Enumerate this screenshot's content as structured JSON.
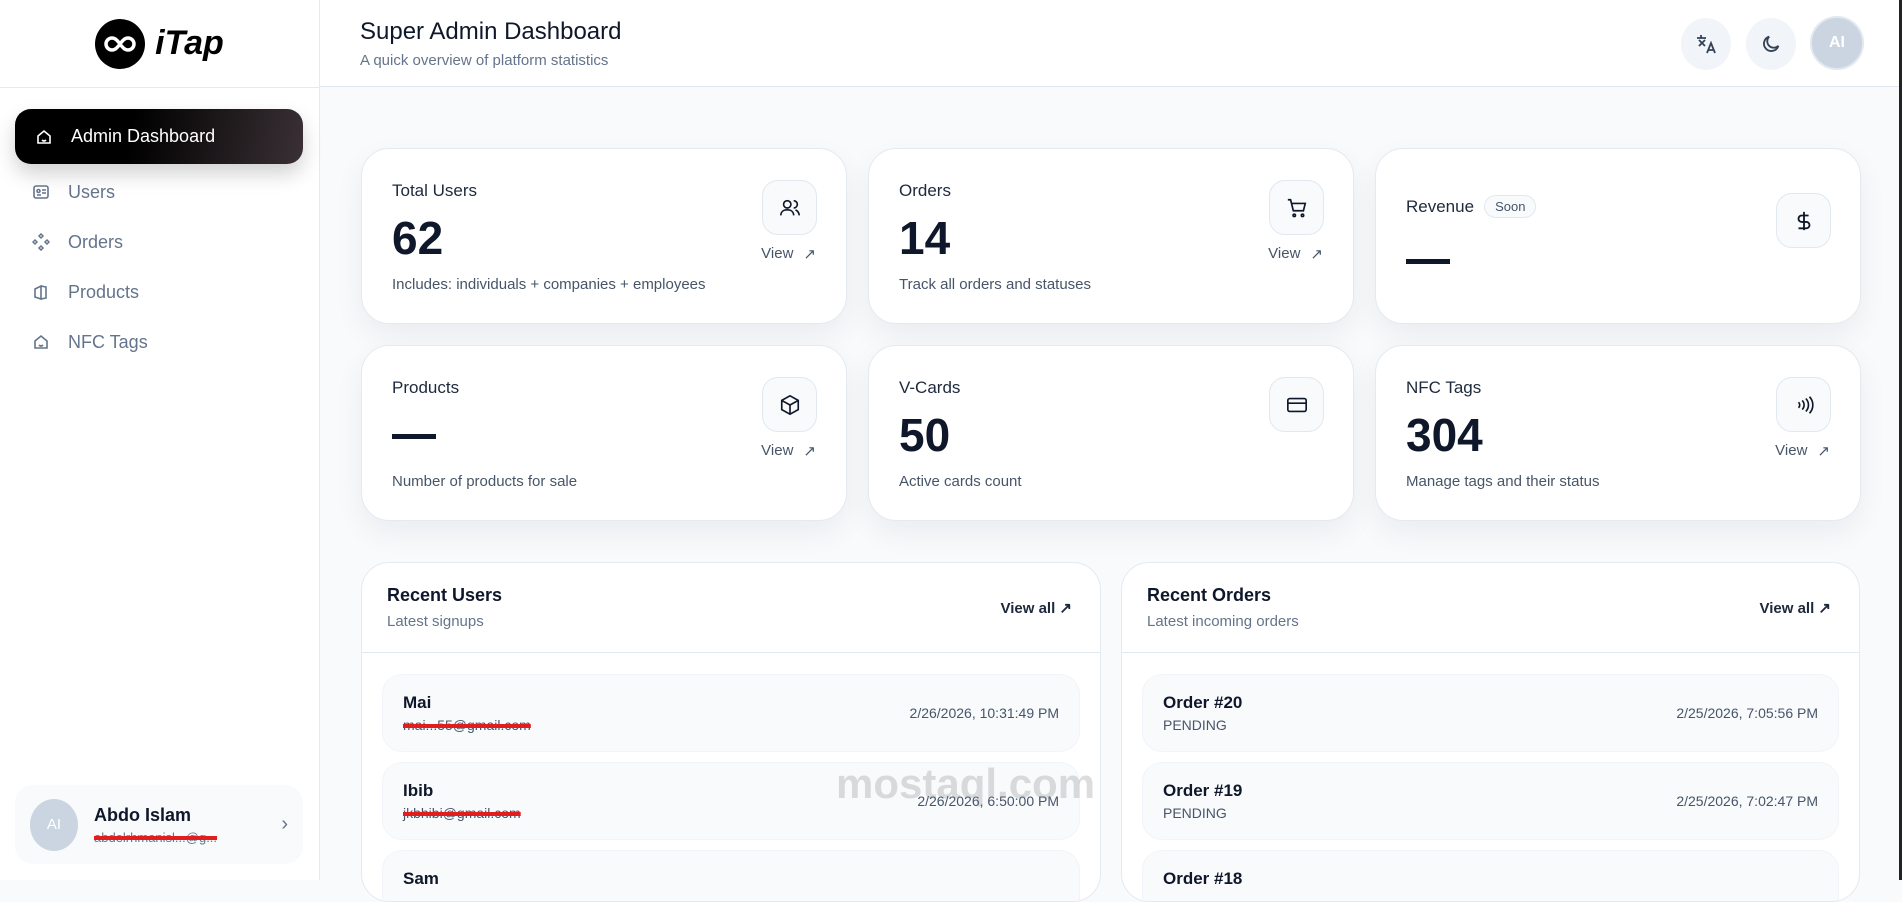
{
  "brand": {
    "name": "iTap"
  },
  "sidebar": {
    "items": [
      {
        "label": "Admin Dashboard",
        "icon": "home-icon",
        "active": true
      },
      {
        "label": "Users",
        "icon": "id-card-icon"
      },
      {
        "label": "Orders",
        "icon": "diamonds-icon"
      },
      {
        "label": "Products",
        "icon": "product-icon"
      },
      {
        "label": "NFC Tags",
        "icon": "home-icon"
      }
    ],
    "user": {
      "initials": "AI",
      "name": "Abdo Islam",
      "email": "abdelrhmanisl...@g..."
    }
  },
  "header": {
    "title": "Super Admin Dashboard",
    "subtitle": "A quick overview of platform statistics",
    "avatar": "AI"
  },
  "cards": [
    {
      "title": "Total Users",
      "value": "62",
      "desc": "Includes: individuals + companies + employees",
      "view": "View",
      "icon": "users-icon"
    },
    {
      "title": "Orders",
      "value": "14",
      "desc": "Track all orders and statuses",
      "view": "View",
      "icon": "cart-icon"
    },
    {
      "title": "Revenue",
      "badge": "Soon",
      "value": "—",
      "icon": "dollar-icon"
    },
    {
      "title": "Products",
      "value": "—",
      "desc": "Number of products for sale",
      "view": "View",
      "icon": "box-icon"
    },
    {
      "title": "V-Cards",
      "value": "50",
      "desc": "Active cards count",
      "icon": "card-icon"
    },
    {
      "title": "NFC Tags",
      "value": "304",
      "desc": "Manage tags and their status",
      "view": "View",
      "icon": "nfc-icon"
    }
  ],
  "recent_users": {
    "title": "Recent Users",
    "subtitle": "Latest signups",
    "view_all": "View all",
    "rows": [
      {
        "name": "Mai",
        "email": "mai...55@gmail.com",
        "time": "2/26/2026, 10:31:49 PM"
      },
      {
        "name": "Ibib",
        "email": "jkbhibi@gmail.com",
        "time": "2/26/2026, 6:50:00 PM"
      },
      {
        "name": "Sam",
        "email": "",
        "time": ""
      }
    ]
  },
  "recent_orders": {
    "title": "Recent Orders",
    "subtitle": "Latest incoming orders",
    "view_all": "View all",
    "rows": [
      {
        "name": "Order #20",
        "status": "PENDING",
        "time": "2/25/2026, 7:05:56 PM"
      },
      {
        "name": "Order #19",
        "status": "PENDING",
        "time": "2/25/2026, 7:02:47 PM"
      },
      {
        "name": "Order #18",
        "status": "",
        "time": ""
      }
    ]
  },
  "watermark": "mostaql.com"
}
